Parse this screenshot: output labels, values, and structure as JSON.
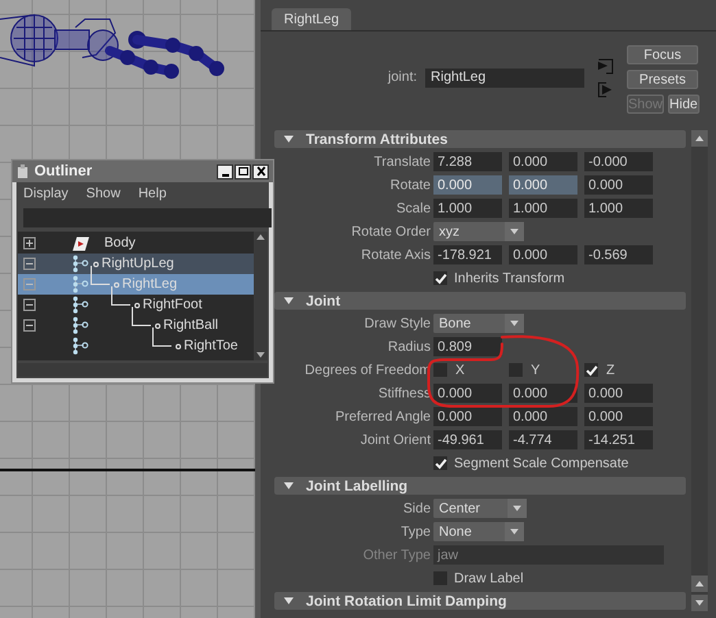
{
  "outliner": {
    "title": "Outliner",
    "menus": [
      {
        "label": "Display"
      },
      {
        "label": "Show"
      },
      {
        "label": "Help"
      }
    ],
    "items": [
      {
        "label": "Body",
        "kind": "set",
        "expanded": false,
        "selected": false,
        "highlighted": false
      },
      {
        "label": "RightUpLeg",
        "kind": "joint",
        "expanded": true,
        "selected": false,
        "highlighted": true,
        "children": [
          {
            "label": "RightLeg",
            "kind": "joint",
            "expanded": true,
            "selected": true,
            "highlighted": false,
            "children": [
              {
                "label": "RightFoot",
                "kind": "joint",
                "expanded": true,
                "selected": false,
                "highlighted": false,
                "children": [
                  {
                    "label": "RightBall",
                    "kind": "joint",
                    "expanded": true,
                    "selected": false,
                    "highlighted": false,
                    "children": [
                      {
                        "label": "RightToe",
                        "kind": "joint",
                        "selected": false,
                        "highlighted": false
                      }
                    ]
                  }
                ]
              }
            ]
          }
        ]
      }
    ]
  },
  "attribute_editor": {
    "tabs": [
      {
        "label": "RightLeg",
        "selected": true
      }
    ],
    "node": {
      "label": "joint:",
      "value": "RightLeg"
    },
    "buttons": [
      {
        "label": "Focus",
        "disabled": false
      },
      {
        "label": "Presets",
        "disabled": false
      },
      {
        "label": "Show",
        "disabled": true
      },
      {
        "label": "Hide",
        "disabled": false
      }
    ],
    "highlight_circle": true,
    "sections": [
      {
        "title": "Transform Attributes",
        "rows": [
          {
            "kind": "vector",
            "label": "Translate",
            "fields": [
              {
                "value": "7.288",
                "highlighted": false
              },
              {
                "value": "0.000",
                "highlighted": false
              },
              {
                "value": "-0.000",
                "highlighted": false
              }
            ]
          },
          {
            "kind": "vector",
            "label": "Rotate",
            "fields": [
              {
                "value": "0.000",
                "highlighted": true
              },
              {
                "value": "0.000",
                "highlighted": true
              },
              {
                "value": "0.000",
                "highlighted": false
              }
            ]
          },
          {
            "kind": "vector",
            "label": "Scale",
            "fields": [
              {
                "value": "1.000",
                "highlighted": false
              },
              {
                "value": "1.000",
                "highlighted": false
              },
              {
                "value": "1.000",
                "highlighted": false
              }
            ]
          },
          {
            "kind": "dropdown",
            "label": "Rotate Order",
            "value": "xyz"
          },
          {
            "kind": "vector",
            "label": "Rotate Axis",
            "fields": [
              {
                "value": "-178.921",
                "highlighted": false
              },
              {
                "value": "0.000",
                "highlighted": false
              },
              {
                "value": "-0.569",
                "highlighted": false
              }
            ]
          },
          {
            "kind": "checkbox",
            "label": "Inherits Transform",
            "checked": true
          }
        ]
      },
      {
        "title": "Joint",
        "rows": [
          {
            "kind": "dropdown",
            "label": "Draw Style",
            "value": "Bone"
          },
          {
            "kind": "float",
            "label": "Radius",
            "value": "0.809"
          },
          {
            "kind": "flags",
            "label": "Degrees of Freedom",
            "flags": [
              {
                "label": "X",
                "checked": false
              },
              {
                "label": "Y",
                "checked": false
              },
              {
                "label": "Z",
                "checked": true
              }
            ]
          },
          {
            "kind": "vector",
            "label": "Stiffness",
            "fields": [
              {
                "value": "0.000",
                "highlighted": false
              },
              {
                "value": "0.000",
                "highlighted": false
              },
              {
                "value": "0.000",
                "highlighted": false
              }
            ]
          },
          {
            "kind": "vector",
            "label": "Preferred Angle",
            "fields": [
              {
                "value": "0.000",
                "highlighted": false
              },
              {
                "value": "0.000",
                "highlighted": false
              },
              {
                "value": "0.000",
                "highlighted": false
              }
            ]
          },
          {
            "kind": "vector",
            "label": "Joint Orient",
            "fields": [
              {
                "value": "-49.961",
                "highlighted": false
              },
              {
                "value": "-4.774",
                "highlighted": false
              },
              {
                "value": "-14.251",
                "highlighted": false
              }
            ]
          },
          {
            "kind": "checkbox",
            "label": "Segment Scale Compensate",
            "checked": true
          }
        ]
      },
      {
        "title": "Joint Labelling",
        "rows": [
          {
            "kind": "dropdown",
            "label": "Side",
            "value": "Center"
          },
          {
            "kind": "dropdown",
            "label": "Type",
            "value": "None"
          },
          {
            "kind": "text",
            "label": "Other Type",
            "value": "jaw",
            "disabled": true
          },
          {
            "kind": "checkbox",
            "label": "Draw Label",
            "checked": false
          }
        ]
      },
      {
        "title": "Joint Rotation Limit Damping"
      }
    ]
  }
}
